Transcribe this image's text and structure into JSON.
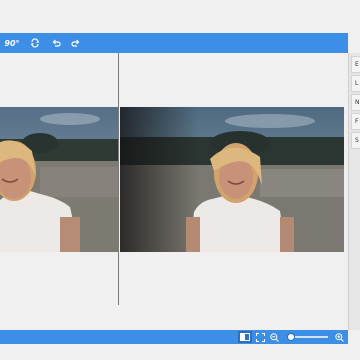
{
  "toolbar": {
    "buttons": [
      {
        "name": "rotate-90-button",
        "label": "90°",
        "icon": "rotate-90-icon"
      },
      {
        "name": "repeat-button",
        "icon": "repeat-icon"
      },
      {
        "name": "undo-button",
        "icon": "undo-icon"
      },
      {
        "name": "redo-button",
        "icon": "redo-icon"
      }
    ],
    "color": "#3d8ee6"
  },
  "right_panel": {
    "items": [
      "E",
      "L",
      "N",
      "F",
      "S"
    ]
  },
  "bottom_bar": {
    "view_buttons": [
      "compare-view-icon",
      "fit-view-icon"
    ],
    "zoom_out_icon": "zoom-out-icon",
    "zoom_in_icon": "zoom-in-icon",
    "zoom_level": 0.05
  }
}
